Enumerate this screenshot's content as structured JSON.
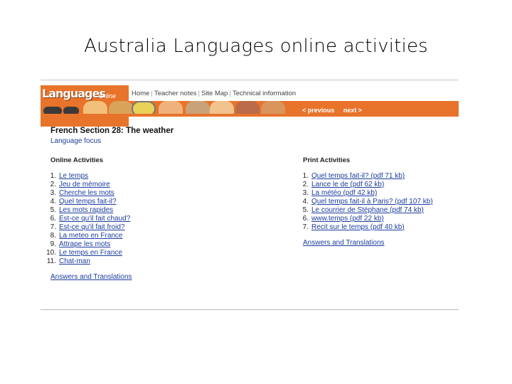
{
  "slide": {
    "title": "Australia Languages online activities"
  },
  "site": {
    "logo": "Languages",
    "logo_sub": "online",
    "nav": [
      "Home",
      "Teacher notes",
      "Site Map",
      "Technical information"
    ],
    "prev_label": "< previous",
    "next_label": "next >",
    "accent_color": "#e8732a"
  },
  "page": {
    "title": "French Section 28: The weather",
    "language_focus": "Language focus"
  },
  "online": {
    "heading": "Online Activities",
    "items": [
      {
        "num": "1.",
        "label": "Le temps"
      },
      {
        "num": "2.",
        "label": "Jeu de mémoire"
      },
      {
        "num": "3.",
        "label": "Cherche les mots"
      },
      {
        "num": "4.",
        "label": "Quel temps fait-il?"
      },
      {
        "num": "5.",
        "label": "Les mots rapides"
      },
      {
        "num": "6.",
        "label": "Est-ce qu'il fait chaud?"
      },
      {
        "num": "7.",
        "label": "Est-ce qu'il fait froid?"
      },
      {
        "num": "8.",
        "label": "La meteo en France"
      },
      {
        "num": "9.",
        "label": "Attrape les mots"
      },
      {
        "num": "10.",
        "label": "Le temps en France"
      },
      {
        "num": "11.",
        "label": "Chat-man"
      }
    ],
    "answers": "Answers and Translations"
  },
  "print": {
    "heading": "Print Activities",
    "items": [
      {
        "num": "1.",
        "label": "Quel temps fait-il? (pdf 71 kb)"
      },
      {
        "num": "2.",
        "label": "Lance le de (pdf 62 kb)"
      },
      {
        "num": "3.",
        "label": "La météo (pdf 42 kb)"
      },
      {
        "num": "4.",
        "label": "Quel temps fait-il à Paris? (pdf 107 kb)"
      },
      {
        "num": "5.",
        "label": "Le courrier de Stéphane (pdf 74 kb)"
      },
      {
        "num": "6.",
        "label": "www.temps (pdf 22 kb)"
      },
      {
        "num": "7.",
        "label": "Recit sur le temps (pdf 40 kb)"
      }
    ],
    "answers": "Answers and Translations"
  }
}
